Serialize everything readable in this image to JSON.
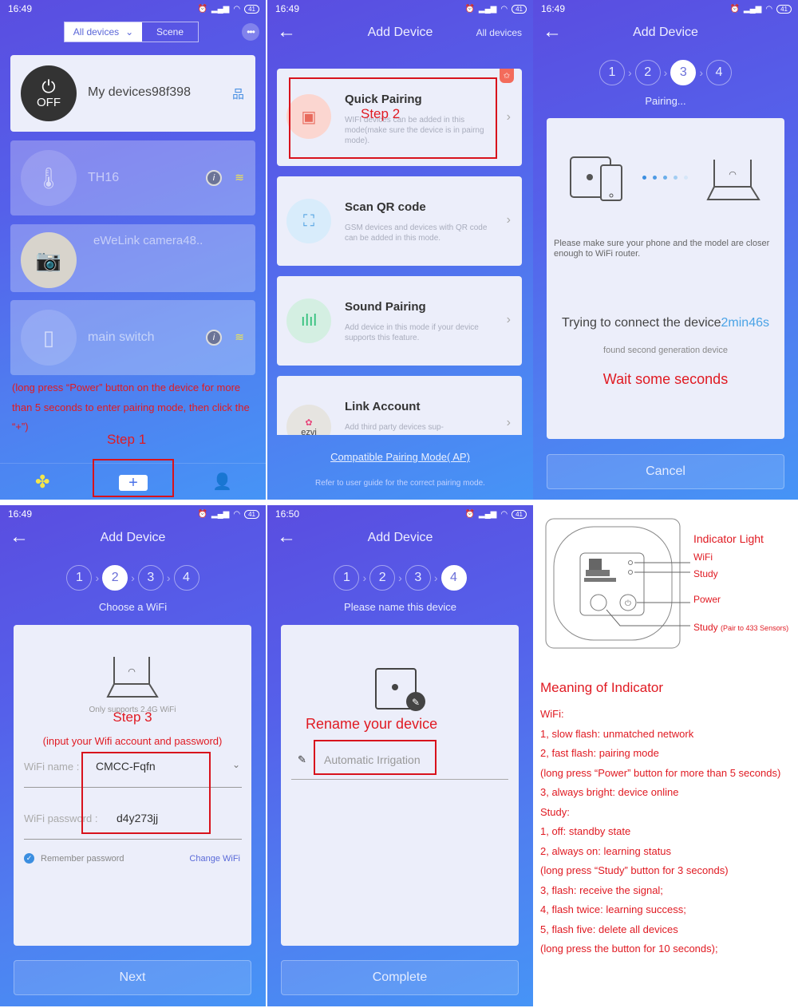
{
  "status": {
    "p1_time": "16:49",
    "p2_time": "16:49",
    "p3_time": "16:49",
    "p4_time": "16:49",
    "p5_time": "16:50",
    "battery": "41"
  },
  "home": {
    "tab_all": "All devices",
    "tab_scene": "Scene",
    "devices": [
      {
        "name": "My devices98f398",
        "power_label": "OFF"
      },
      {
        "name": "TH16"
      },
      {
        "name": "eWeLink camera48.."
      },
      {
        "name": "main switch"
      }
    ],
    "annotation": "(long press “Power” button on the device for more than 5 seconds to enter pairing mode, then click the “+”)",
    "step_label": "Step 1",
    "plus": "+"
  },
  "add": {
    "title": "Add Device",
    "top_right": "All devices",
    "step_label": "Step 2",
    "modes": [
      {
        "title": "Quick Pairing",
        "desc": "WIFI devices can be added in this mode(make sure the device is in pairng mode)."
      },
      {
        "title": "Scan QR code",
        "desc": "GSM devices and devices with QR code can be added in this mode."
      },
      {
        "title": "Sound Pairing",
        "desc": "Add device in this mode if your device supports this feature."
      },
      {
        "title": "Link Account",
        "desc": "Add third party devices sup-",
        "logo_text": "ezvi"
      }
    ],
    "compat_link": "Compatible Pairing Mode( AP)",
    "refer_text": "Refer to user guide for the correct pairing mode."
  },
  "steps": [
    "1",
    "2",
    "3",
    "4"
  ],
  "pairing": {
    "title": "Add Device",
    "subtitle": "Pairing...",
    "hint": "Please make sure your phone and the model are closer enough to WiFi router.",
    "trying": "Trying to connect the device",
    "timer": "2min46s",
    "found": "found second generation device",
    "annotation": "Wait some seconds",
    "cancel": "Cancel"
  },
  "wifi": {
    "title": "Add Device",
    "subtitle": "Choose a WiFi",
    "only_24": "Only supports 2.4G WiFi",
    "step_label": "Step 3",
    "annotation": "(input your Wifi account and password)",
    "name_label": "WiFi name :",
    "name_value": "CMCC-Fqfn",
    "pass_label": "WiFi password :",
    "pass_value": "d4y273jj",
    "remember": "Remember password",
    "change": "Change WiFi",
    "next": "Next"
  },
  "naming": {
    "title": "Add Device",
    "subtitle": "Please name this device",
    "annotation": "Rename your device",
    "input_value": "Automatic Irrigation",
    "complete": "Complete"
  },
  "indicator": {
    "heading": "Indicator Light",
    "labels": [
      "WiFi",
      "Study",
      "Power",
      "Study"
    ],
    "study_note": "(Pair to 433 Sensors)",
    "meaning_title": "Meaning of Indicator",
    "lines": [
      "WiFi:",
      "1, slow flash: unmatched network",
      "2, fast flash: pairing mode",
      "(long press “Power” button for more than 5 seconds)",
      "3, always bright: device online",
      "Study:",
      "1, off: standby state",
      "2, always on: learning status",
      "(long press “Study” button for 3 seconds)",
      "3, flash: receive the signal;",
      "4, flash twice: learning success;",
      "5, flash five: delete all devices",
      "(long press the button for 10 seconds);"
    ]
  }
}
